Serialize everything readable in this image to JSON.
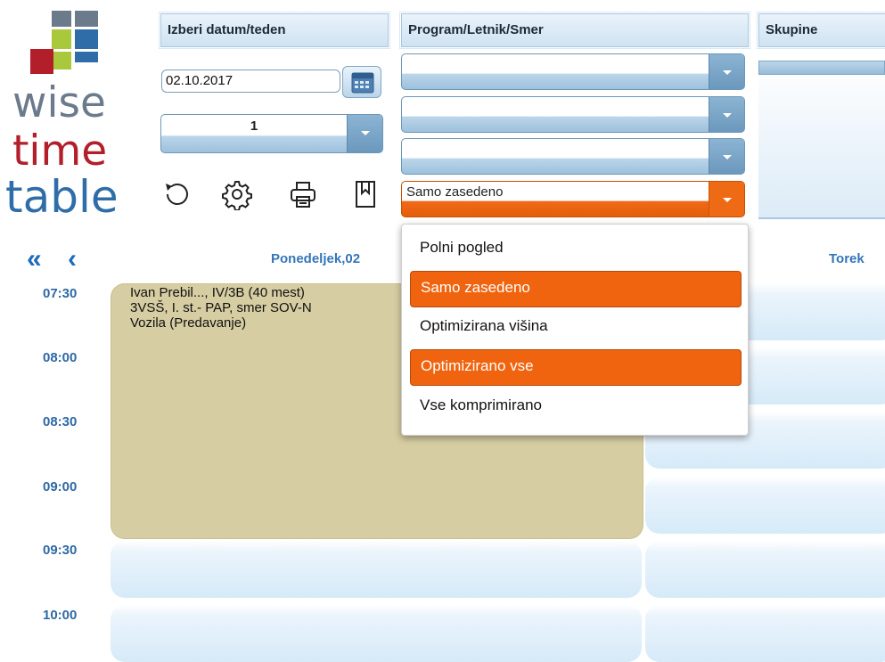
{
  "logo": {
    "line1": "wise",
    "line2": "time",
    "line3": "table",
    "colors": {
      "gray": "#6b7b8c",
      "red": "#b21f2b",
      "green": "#a9c83c",
      "blue": "#2f6da9"
    }
  },
  "header": {
    "date_panel_title": "Izberi datum/teden",
    "program_panel_title": "Program/Letnik/Smer",
    "groups_panel_title": "Skupine",
    "date_value": "02.10.2017",
    "week_value": "1",
    "program_dropdowns": [
      "",
      "",
      ""
    ],
    "view_mode_value": "Samo zasedeno"
  },
  "toolbar": {
    "refresh_icon": "refresh-icon",
    "settings_icon": "gear-icon",
    "print_icon": "printer-icon",
    "bookmark_icon": "bookmark-icon"
  },
  "schedule": {
    "nav_first": "«",
    "nav_prev": "‹",
    "day1": "Ponedeljek,02",
    "day2": "Torek",
    "times": [
      "07:30",
      "08:00",
      "08:30",
      "09:00",
      "09:30",
      "10:00"
    ],
    "event": {
      "line1": "Ivan Prebil..., IV/3B (40 mest)",
      "line2": "3VSŠ, I. st.- PAP, smer  SOV-N",
      "line3": "Vozila (Predavanje)",
      "color": "#d6cda2"
    }
  },
  "view_menu": {
    "items": [
      "Polni pogled",
      "Samo zasedeno",
      "Optimizirana višina",
      "Optimizirano vse",
      "Vse komprimirano"
    ],
    "selected_color": "#f0640f"
  }
}
